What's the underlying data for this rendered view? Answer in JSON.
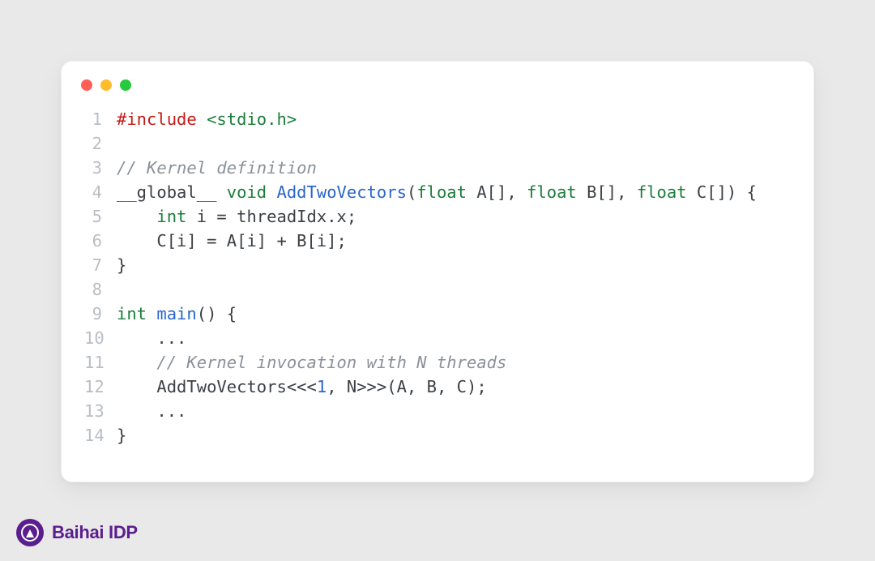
{
  "footer": {
    "brand": "Baihai IDP"
  },
  "code": {
    "lines": [
      {
        "n": "1",
        "tokens": [
          {
            "c": "tok-preproc",
            "t": "#include"
          },
          {
            "c": "tok-plain",
            "t": " "
          },
          {
            "c": "tok-anglestr",
            "t": "<stdio.h>"
          }
        ]
      },
      {
        "n": "2",
        "tokens": [
          {
            "c": "tok-plain",
            "t": ""
          }
        ]
      },
      {
        "n": "3",
        "tokens": [
          {
            "c": "tok-comment",
            "t": "// Kernel definition"
          }
        ]
      },
      {
        "n": "4",
        "tokens": [
          {
            "c": "tok-plain",
            "t": "__global__ "
          },
          {
            "c": "tok-keyword",
            "t": "void"
          },
          {
            "c": "tok-plain",
            "t": " "
          },
          {
            "c": "tok-func",
            "t": "AddTwoVectors"
          },
          {
            "c": "tok-punct",
            "t": "("
          },
          {
            "c": "tok-keyword",
            "t": "float"
          },
          {
            "c": "tok-plain",
            "t": " A[], "
          },
          {
            "c": "tok-keyword",
            "t": "float"
          },
          {
            "c": "tok-plain",
            "t": " B[], "
          },
          {
            "c": "tok-keyword",
            "t": "float"
          },
          {
            "c": "tok-plain",
            "t": " C[]) {"
          }
        ]
      },
      {
        "n": "5",
        "tokens": [
          {
            "c": "tok-plain",
            "t": "    "
          },
          {
            "c": "tok-keyword",
            "t": "int"
          },
          {
            "c": "tok-plain",
            "t": " i = threadIdx.x;"
          }
        ]
      },
      {
        "n": "6",
        "tokens": [
          {
            "c": "tok-plain",
            "t": "    C[i] = A[i] + B[i];"
          }
        ]
      },
      {
        "n": "7",
        "tokens": [
          {
            "c": "tok-plain",
            "t": "}"
          }
        ]
      },
      {
        "n": "8",
        "tokens": [
          {
            "c": "tok-plain",
            "t": ""
          }
        ]
      },
      {
        "n": "9",
        "tokens": [
          {
            "c": "tok-keyword",
            "t": "int"
          },
          {
            "c": "tok-plain",
            "t": " "
          },
          {
            "c": "tok-func",
            "t": "main"
          },
          {
            "c": "tok-plain",
            "t": "() {"
          }
        ]
      },
      {
        "n": "10",
        "tokens": [
          {
            "c": "tok-plain",
            "t": "    ..."
          }
        ]
      },
      {
        "n": "11",
        "tokens": [
          {
            "c": "tok-plain",
            "t": "    "
          },
          {
            "c": "tok-comment",
            "t": "// Kernel invocation with N threads"
          }
        ]
      },
      {
        "n": "12",
        "tokens": [
          {
            "c": "tok-plain",
            "t": "    AddTwoVectors<<<"
          },
          {
            "c": "tok-number",
            "t": "1"
          },
          {
            "c": "tok-plain",
            "t": ", N>>>(A, B, C);"
          }
        ]
      },
      {
        "n": "13",
        "tokens": [
          {
            "c": "tok-plain",
            "t": "    ..."
          }
        ]
      },
      {
        "n": "14",
        "tokens": [
          {
            "c": "tok-plain",
            "t": "}"
          }
        ]
      }
    ]
  }
}
